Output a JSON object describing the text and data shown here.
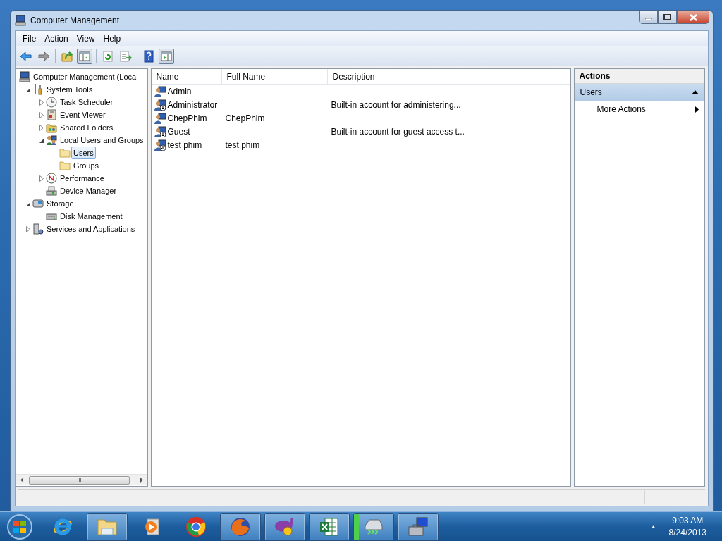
{
  "window": {
    "title": "Computer Management"
  },
  "menu": [
    "File",
    "Action",
    "View",
    "Help"
  ],
  "toolbar": [
    {
      "kind": "back",
      "pressed": false
    },
    {
      "kind": "forward",
      "pressed": false
    },
    {
      "kind": "separator"
    },
    {
      "kind": "up",
      "pressed": false
    },
    {
      "kind": "tree-toggle",
      "pressed": true
    },
    {
      "kind": "separator"
    },
    {
      "kind": "refresh",
      "pressed": false
    },
    {
      "kind": "export",
      "pressed": false
    },
    {
      "kind": "separator"
    },
    {
      "kind": "help",
      "pressed": false
    },
    {
      "kind": "pane-toggle",
      "pressed": true
    }
  ],
  "tree": [
    {
      "label": "Computer Management (Local",
      "kind": "computer",
      "selected": false,
      "children": [
        {
          "label": "System Tools",
          "kind": "tools",
          "expanded": true,
          "selected": false,
          "children": [
            {
              "label": "Task Scheduler",
              "kind": "clock",
              "expanded": false,
              "selected": false
            },
            {
              "label": "Event Viewer",
              "kind": "log",
              "expanded": false,
              "selected": false
            },
            {
              "label": "Shared Folders",
              "kind": "share",
              "expanded": false,
              "selected": false
            },
            {
              "label": "Local Users and Groups",
              "kind": "users",
              "expanded": true,
              "selected": false,
              "children": [
                {
                  "label": "Users",
                  "kind": "folder",
                  "selected": true
                },
                {
                  "label": "Groups",
                  "kind": "folder",
                  "selected": false
                }
              ]
            },
            {
              "label": "Performance",
              "kind": "gauge",
              "expanded": false,
              "selected": false
            },
            {
              "label": "Device Manager",
              "kind": "device",
              "selected": false
            }
          ]
        },
        {
          "label": "Storage",
          "kind": "storage",
          "expanded": true,
          "selected": false,
          "children": [
            {
              "label": "Disk Management",
              "kind": "disk",
              "selected": false
            }
          ]
        },
        {
          "label": "Services and Applications",
          "kind": "services",
          "expanded": false,
          "selected": false
        }
      ]
    }
  ],
  "tree_scrollbar": {
    "grip": "III"
  },
  "table": {
    "columns": [
      "Name",
      "Full Name",
      "Description"
    ],
    "rows": [
      {
        "name": "Admin",
        "full_name": "",
        "description": "",
        "disabled": false
      },
      {
        "name": "Administrator",
        "full_name": "",
        "description": "Built-in account for administering...",
        "disabled": true
      },
      {
        "name": "ChepPhim",
        "full_name": "ChepPhim",
        "description": "",
        "disabled": false
      },
      {
        "name": "Guest",
        "full_name": "",
        "description": "Built-in account for guest access t...",
        "disabled": true
      },
      {
        "name": "test phim",
        "full_name": "test phim",
        "description": "",
        "disabled": true
      }
    ]
  },
  "actions": {
    "title": "Actions",
    "sections": [
      {
        "label": "Users",
        "expanded": true,
        "items": [
          "More Actions"
        ]
      }
    ]
  },
  "taskbar": {
    "items": [
      {
        "kind": "browser",
        "open": false
      },
      {
        "kind": "folders",
        "open": true
      },
      {
        "kind": "media",
        "open": false
      },
      {
        "kind": "round-logo",
        "open": false
      },
      {
        "kind": "fox",
        "open": true
      },
      {
        "kind": "messenger",
        "open": true
      },
      {
        "kind": "spreadsheet",
        "open": true
      },
      {
        "kind": "drive",
        "open": true,
        "level": 0.12
      },
      {
        "kind": "toolbox",
        "open": true
      }
    ],
    "tray_arrow": "▲",
    "time": "9:03 AM",
    "date": "8/24/2013"
  }
}
